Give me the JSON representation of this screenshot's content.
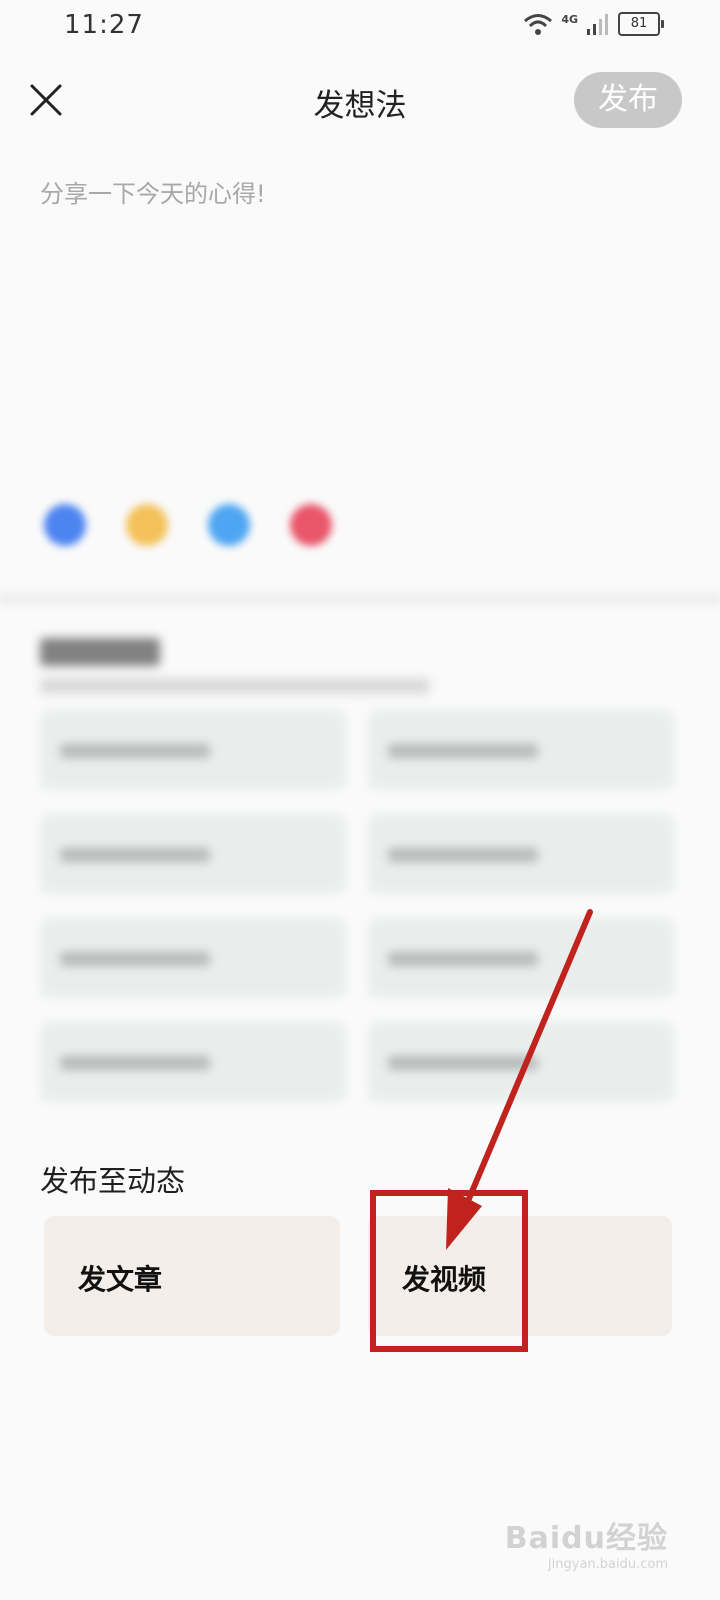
{
  "status_bar": {
    "time": "11:27",
    "network": "4G",
    "battery": "81"
  },
  "header": {
    "title": "发想法",
    "publish_label": "发布"
  },
  "editor": {
    "placeholder": "分享一下今天的心得!"
  },
  "toolbar": {
    "icons": [
      "image-icon",
      "emoji-icon",
      "photo-icon",
      "video-icon"
    ],
    "colors": [
      "#4c84f0",
      "#f4c15a",
      "#4ea5f2",
      "#e9566a"
    ]
  },
  "dynamic": {
    "title": "发布至动态",
    "article_label": "发文章",
    "video_label": "发视频"
  },
  "annotation": {
    "color": "#c0231d"
  },
  "watermark": {
    "main": "Baidu经验",
    "sub": "jingyan.baidu.com"
  }
}
